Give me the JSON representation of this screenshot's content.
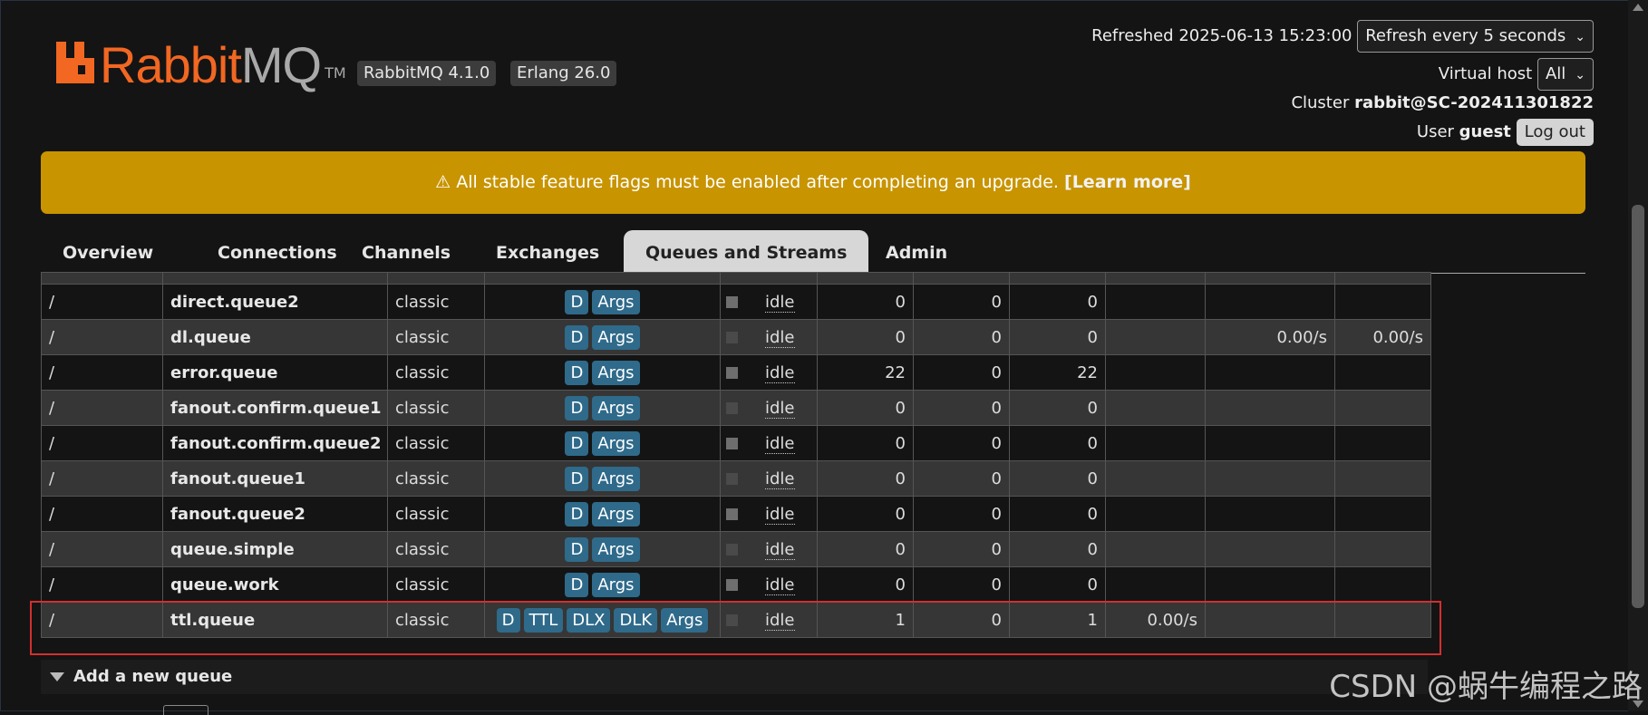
{
  "brand": {
    "rabbit": "Rabbit",
    "mq": "MQ",
    "tm": "TM"
  },
  "versions": {
    "rabbitmq": "RabbitMQ 4.1.0",
    "erlang": "Erlang 26.0"
  },
  "header": {
    "refreshed_label": "Refreshed 2025-06-13 15:23:00",
    "refresh_select": "Refresh every 5 seconds",
    "vhost_label": "Virtual host",
    "vhost_select": "All",
    "cluster_label": "Cluster",
    "cluster_value": "rabbit@SC-202411301822",
    "user_label": "User",
    "user_value": "guest",
    "logout": "Log out"
  },
  "banner": {
    "text": "⚠ All stable feature flags must be enabled after completing an upgrade.",
    "link": "[Learn more]"
  },
  "tabs": [
    "Overview",
    "Connections",
    "Channels",
    "Exchanges",
    "Queues and Streams",
    "Admin"
  ],
  "active_tab": "Queues and Streams",
  "queues": [
    {
      "vhost": "/",
      "name": "direct.queue2",
      "type": "classic",
      "features": [
        "D",
        "Args"
      ],
      "state": "idle",
      "ready": "0",
      "unacked": "0",
      "total": "0",
      "incoming": "",
      "deliver": "",
      "ack": ""
    },
    {
      "vhost": "/",
      "name": "dl.queue",
      "type": "classic",
      "features": [
        "D",
        "Args"
      ],
      "state": "idle",
      "ready": "0",
      "unacked": "0",
      "total": "0",
      "incoming": "",
      "deliver": "0.00/s",
      "ack": "0.00/s"
    },
    {
      "vhost": "/",
      "name": "error.queue",
      "type": "classic",
      "features": [
        "D",
        "Args"
      ],
      "state": "idle",
      "ready": "22",
      "unacked": "0",
      "total": "22",
      "incoming": "",
      "deliver": "",
      "ack": ""
    },
    {
      "vhost": "/",
      "name": "fanout.confirm.queue1",
      "type": "classic",
      "features": [
        "D",
        "Args"
      ],
      "state": "idle",
      "ready": "0",
      "unacked": "0",
      "total": "0",
      "incoming": "",
      "deliver": "",
      "ack": ""
    },
    {
      "vhost": "/",
      "name": "fanout.confirm.queue2",
      "type": "classic",
      "features": [
        "D",
        "Args"
      ],
      "state": "idle",
      "ready": "0",
      "unacked": "0",
      "total": "0",
      "incoming": "",
      "deliver": "",
      "ack": ""
    },
    {
      "vhost": "/",
      "name": "fanout.queue1",
      "type": "classic",
      "features": [
        "D",
        "Args"
      ],
      "state": "idle",
      "ready": "0",
      "unacked": "0",
      "total": "0",
      "incoming": "",
      "deliver": "",
      "ack": ""
    },
    {
      "vhost": "/",
      "name": "fanout.queue2",
      "type": "classic",
      "features": [
        "D",
        "Args"
      ],
      "state": "idle",
      "ready": "0",
      "unacked": "0",
      "total": "0",
      "incoming": "",
      "deliver": "",
      "ack": ""
    },
    {
      "vhost": "/",
      "name": "queue.simple",
      "type": "classic",
      "features": [
        "D",
        "Args"
      ],
      "state": "idle",
      "ready": "0",
      "unacked": "0",
      "total": "0",
      "incoming": "",
      "deliver": "",
      "ack": ""
    },
    {
      "vhost": "/",
      "name": "queue.work",
      "type": "classic",
      "features": [
        "D",
        "Args"
      ],
      "state": "idle",
      "ready": "0",
      "unacked": "0",
      "total": "0",
      "incoming": "",
      "deliver": "",
      "ack": ""
    },
    {
      "vhost": "/",
      "name": "ttl.queue",
      "type": "classic",
      "features": [
        "D",
        "TTL",
        "DLX",
        "DLK",
        "Args"
      ],
      "state": "idle",
      "ready": "1",
      "unacked": "0",
      "total": "1",
      "incoming": "0.00/s",
      "deliver": "",
      "ack": ""
    }
  ],
  "add_queue": "Add a new queue",
  "watermark": "CSDN @蜗牛编程之路",
  "colors": {
    "brand_orange": "#f26722",
    "banner": "#c89400",
    "tag": "#2f6a8a",
    "highlight": "#d32f2f"
  }
}
